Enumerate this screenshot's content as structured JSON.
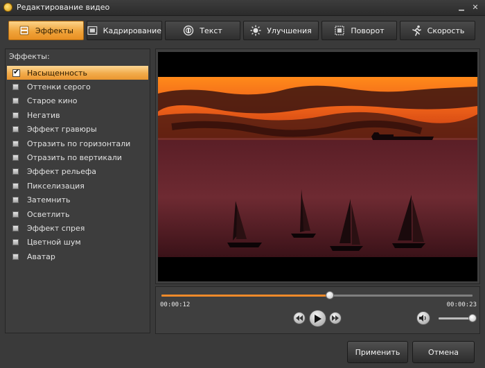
{
  "window": {
    "title": "Редактирование видео",
    "minimize_glyph": "▁",
    "close_glyph": "✕"
  },
  "tabs": [
    {
      "label": "Эффекты",
      "icon": "effects-icon",
      "active": true
    },
    {
      "label": "Кадрирование",
      "icon": "crop-icon",
      "active": false
    },
    {
      "label": "Текст",
      "icon": "text-icon",
      "active": false
    },
    {
      "label": "Улучшения",
      "icon": "brightness-icon",
      "active": false
    },
    {
      "label": "Поворот",
      "icon": "rotate-icon",
      "active": false
    },
    {
      "label": "Скорость",
      "icon": "speed-runner-icon",
      "active": false
    }
  ],
  "effects_panel": {
    "label": "Эффекты:",
    "items": [
      {
        "label": "Насыщенность",
        "checked": true,
        "selected": true
      },
      {
        "label": "Оттенки серого",
        "checked": false
      },
      {
        "label": "Старое кино",
        "checked": false
      },
      {
        "label": "Негатив",
        "checked": false
      },
      {
        "label": "Эффект гравюры",
        "checked": false
      },
      {
        "label": "Отразить по горизонтали",
        "checked": false
      },
      {
        "label": "Отразить по вертикали",
        "checked": false
      },
      {
        "label": "Эффект рельефа",
        "checked": false
      },
      {
        "label": "Пикселизация",
        "checked": false
      },
      {
        "label": "Затемнить",
        "checked": false
      },
      {
        "label": "Осветлить",
        "checked": false
      },
      {
        "label": "Эффект спрея",
        "checked": false
      },
      {
        "label": "Цветной шум",
        "checked": false
      },
      {
        "label": "Аватар",
        "checked": false
      }
    ],
    "check_glyph": "✔"
  },
  "player": {
    "current_time": "00:00:12",
    "total_time": "00:00:23",
    "progress": 0.542,
    "volume": 0.98
  },
  "colors": {
    "accent": "#f0a43a",
    "seek_fill": "#f08a2a",
    "background": "#3a3a3a"
  },
  "buttons": {
    "apply": "Применить",
    "cancel": "Отмена"
  }
}
